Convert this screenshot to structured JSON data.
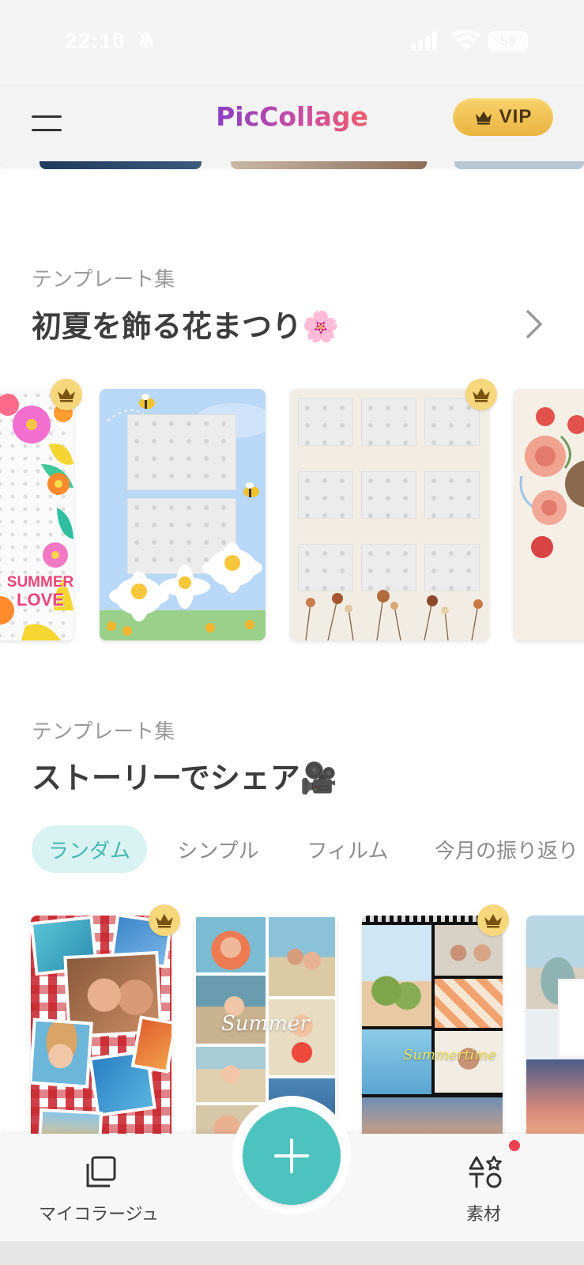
{
  "status_bar": {
    "time": "22:10",
    "battery": "59"
  },
  "header": {
    "logo": "PicCollage",
    "vip_label": "VIP"
  },
  "section1": {
    "subtitle": "テンプレート集",
    "title": "初夏を飾る花まつり🌸",
    "cards": [
      {
        "name": "summer-love",
        "text_line1": "SUMMER",
        "text_line2": "LOVE",
        "premium": true
      },
      {
        "name": "bee-daisy",
        "premium": false
      },
      {
        "name": "dried-flowers-grid",
        "premium": true
      },
      {
        "name": "rose-bouquet",
        "premium": false
      }
    ]
  },
  "section2": {
    "subtitle": "テンプレート集",
    "title": "ストーリーでシェア🎥",
    "chips": [
      "ランダム",
      "シンプル",
      "フィルム",
      "今月の振り返り"
    ],
    "cards": [
      {
        "name": "picnic-collage",
        "premium": true
      },
      {
        "name": "baby-beach",
        "script_text": "Summer",
        "premium": false
      },
      {
        "name": "film-strip",
        "script_text": "Summertime",
        "premium": true
      },
      {
        "name": "van-sunset",
        "premium": false
      }
    ]
  },
  "bottom_nav": {
    "my_collage": "マイコラージュ",
    "materials": "素材"
  },
  "colors": {
    "accent": "#4cc3be",
    "chip_active_bg": "#d9f3f2",
    "vip_gold": "#f0c150",
    "notify": "#ee4250"
  }
}
